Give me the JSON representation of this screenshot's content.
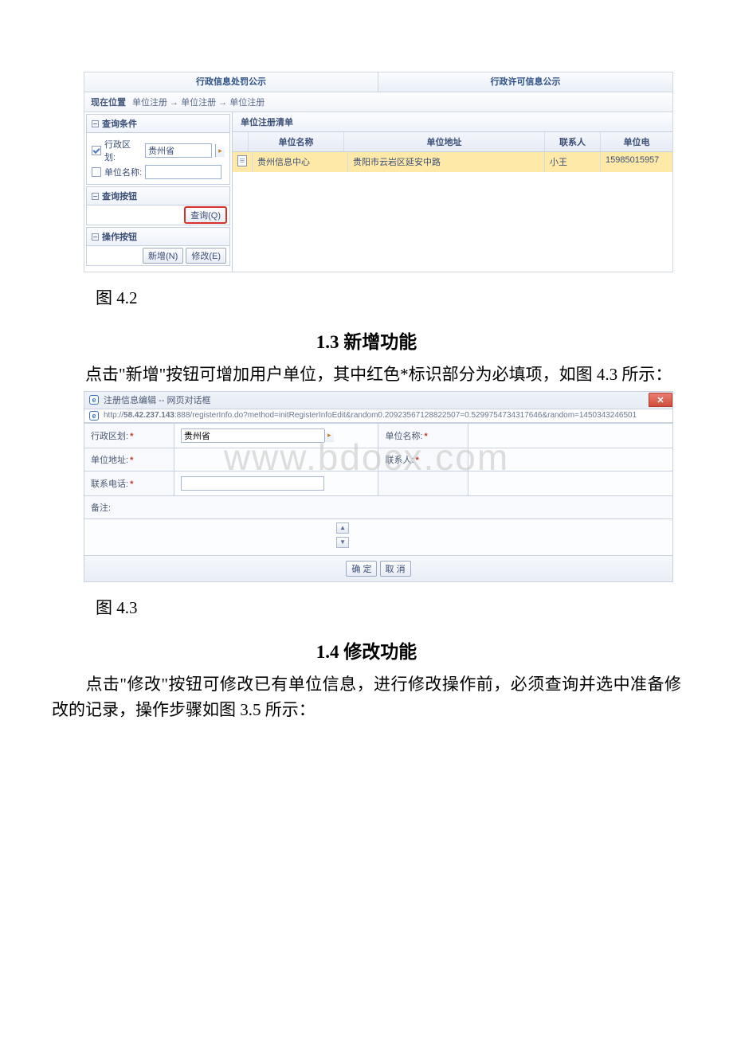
{
  "fig1": {
    "tabs": [
      "行政信息处罚公示",
      "行政许可信息公示"
    ],
    "breadcrumb_label": "现在位置",
    "breadcrumb_path": "单位注册 → 单位注册 → 单位注册",
    "panels": {
      "query_cond": "查询条件",
      "query_btns": "查询按钮",
      "op_btns": "操作按钮"
    },
    "fields": {
      "region_label": "行政区划:",
      "region_value": "贵州省",
      "unit_label": "单位名称:"
    },
    "buttons": {
      "query": "查询(Q)",
      "add": "新增(N)",
      "edit": "修改(E)"
    },
    "list_title": "单位注册清单",
    "cols": [
      "",
      "单位名称",
      "单位地址",
      "联系人",
      "单位电"
    ],
    "row": {
      "name": "贵州信息中心",
      "addr": "贵阳市云岩区延安中路",
      "contact": "小王",
      "phone": "15985015957"
    }
  },
  "cap1": "图 4.2",
  "sec1_title": "1.3 新增功能",
  "para1_a": "点击\"新增\"按钮可增加用户单位，其中红色*标识部分为必填项，如图 4.3 所示：",
  "watermark": "www.bdocx.com",
  "fig2": {
    "title": "注册信息编辑 -- 网页对话框",
    "url_prefix": "http://",
    "url_bold": "58.42.237.143",
    "url_rest": ":888/registerInfo.do?method=initRegisterInfoEdit&random0.20923567128822507=0.5299754734317646&random=1450343246501",
    "labels": {
      "region": "行政区划:",
      "unit_name": "单位名称:",
      "unit_addr": "单位地址:",
      "contact": "联系人:",
      "phone": "联系电话:",
      "remark": "备注:"
    },
    "region_value": "贵州省",
    "ok": "确 定",
    "cancel": "取 消"
  },
  "cap2": "图 4.3",
  "sec2_title": "1.4 修改功能",
  "para2": "点击\"修改\"按钮可修改已有单位信息，进行修改操作前，必须查询并选中准备修改的记录，操作步骤如图 3.5 所示："
}
